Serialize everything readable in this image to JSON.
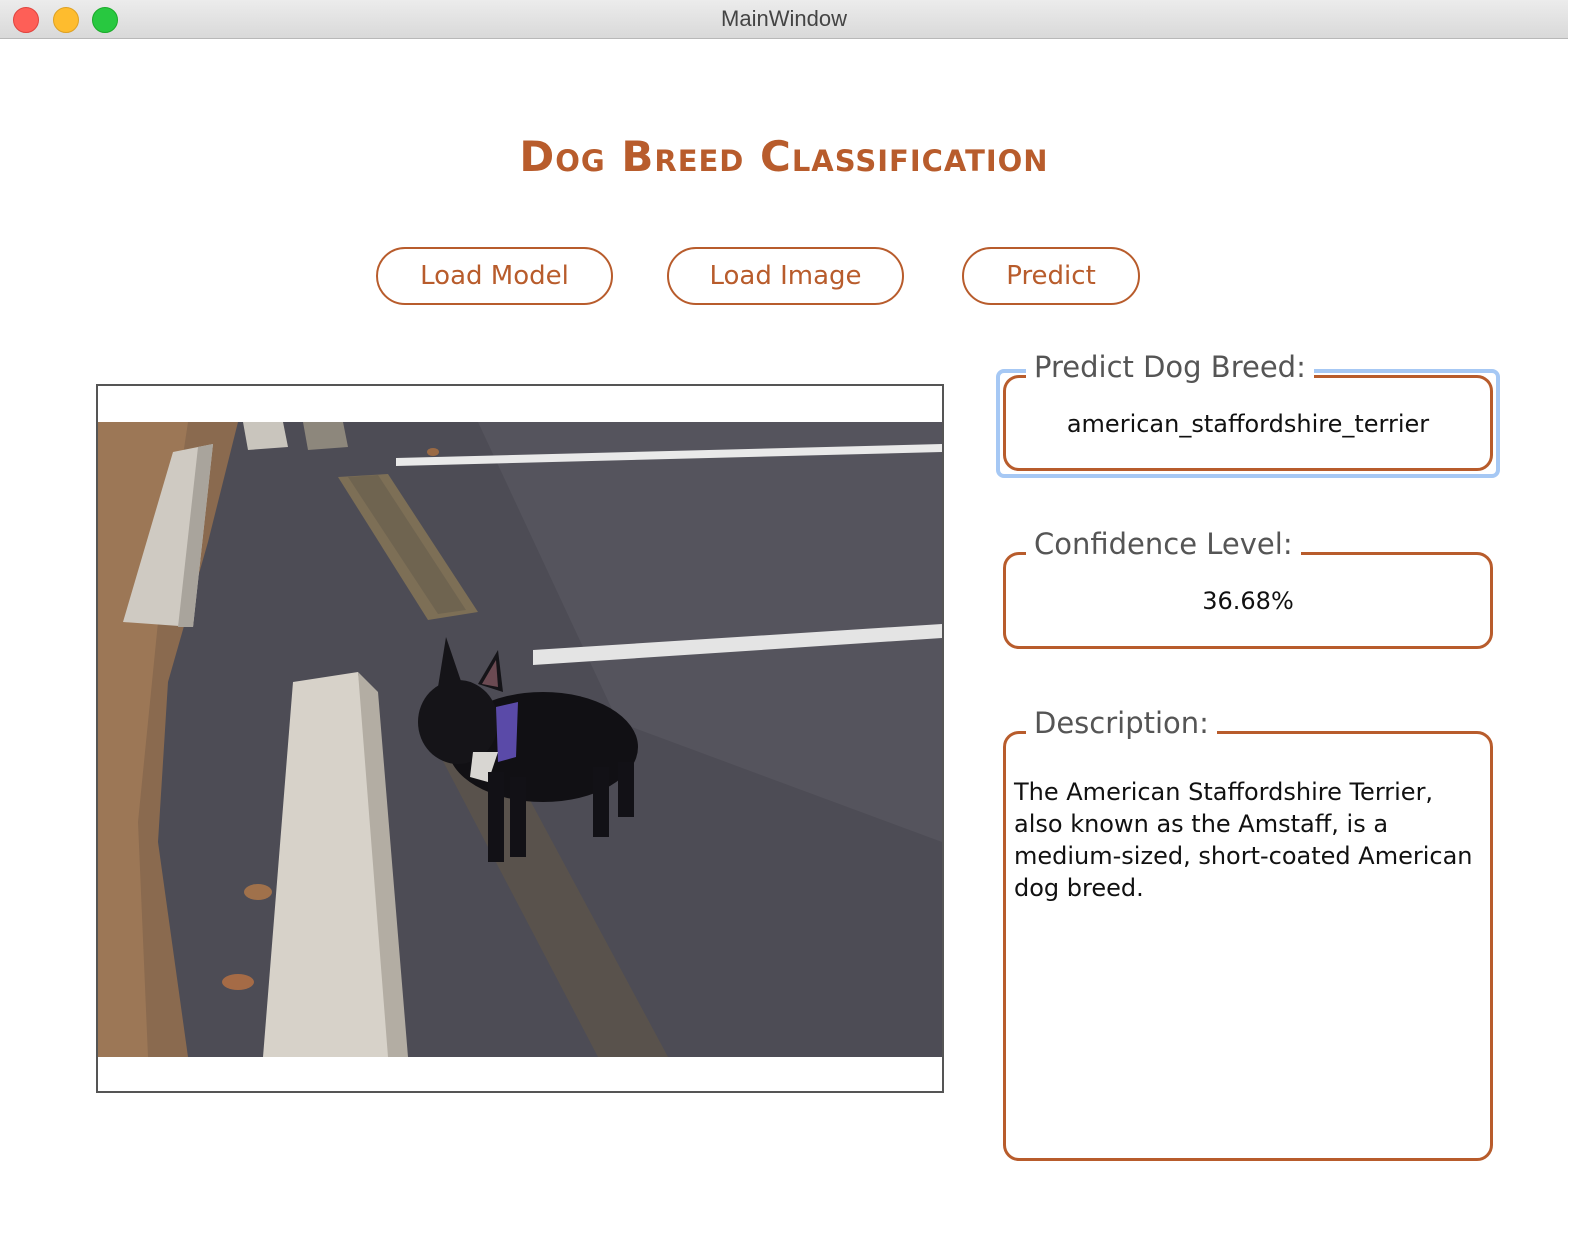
{
  "window": {
    "title": "MainWindow"
  },
  "app": {
    "title": "Dog Breed Classification",
    "accent_color": "#b85c2c"
  },
  "toolbar": {
    "load_model_label": "Load Model",
    "load_image_label": "Load Image",
    "predict_label": "Predict"
  },
  "image": {
    "description": "Photo of a black French bulldog standing on a wet asphalt parking lot next to concrete curb stops"
  },
  "results": {
    "breed_label": "Predict Dog Breed:",
    "breed_value": "american_staffordshire_terrier",
    "confidence_label": "Confidence Level:",
    "confidence_value": "36.68%",
    "description_label": "Description:",
    "description_value": "The American Staffordshire Terrier, also known as the Amstaff, is a medium-sized, short-coated American dog breed."
  }
}
